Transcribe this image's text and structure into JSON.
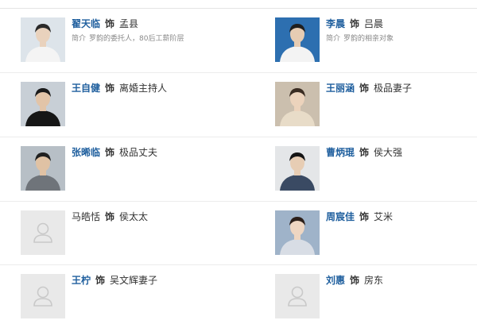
{
  "cast_list": {
    "connector": "饰",
    "summary_label": "简介",
    "rows": [
      [
        {
          "actor": "翟天临",
          "role": "孟县",
          "summary": "罗韵的委托人，80后工薪阶层",
          "photo": "actor-portrait-photo",
          "linked": true
        },
        {
          "actor": "李晨",
          "role": "吕晨",
          "summary": "罗韵的相亲对象",
          "photo": "actor-portrait-photo",
          "linked": true
        }
      ],
      [
        {
          "actor": "王自健",
          "role": "离婚主持人",
          "summary": "",
          "photo": "actor-portrait-photo",
          "linked": true
        },
        {
          "actor": "王丽涵",
          "role": "极品妻子",
          "summary": "",
          "photo": "actor-portrait-photo",
          "linked": true
        }
      ],
      [
        {
          "actor": "张晞临",
          "role": "极品丈夫",
          "summary": "",
          "photo": "actor-portrait-photo",
          "linked": true
        },
        {
          "actor": "曹炳琨",
          "role": "侯大强",
          "summary": "",
          "photo": "actor-portrait-photo",
          "linked": true
        }
      ],
      [
        {
          "actor": "马皓恬",
          "role": "侯太太",
          "summary": "",
          "photo": "placeholder-avatar-icon",
          "linked": false
        },
        {
          "actor": "周宸佳",
          "role": "艾米",
          "summary": "",
          "photo": "actor-portrait-photo",
          "linked": true
        }
      ],
      [
        {
          "actor": "王柠",
          "role": "吴文辉妻子",
          "summary": "",
          "photo": "placeholder-avatar-icon",
          "linked": true
        },
        {
          "actor": "刘惠",
          "role": "房东",
          "summary": "",
          "photo": "placeholder-avatar-icon",
          "linked": true
        }
      ]
    ]
  },
  "colors": {
    "actor_link": "#1f5f9e",
    "text": "#333333",
    "summary_text": "#8a8a8a",
    "divider": "#ececec",
    "placeholder_bg": "#e9e9e9",
    "placeholder_icon": "#c9c9c9"
  }
}
